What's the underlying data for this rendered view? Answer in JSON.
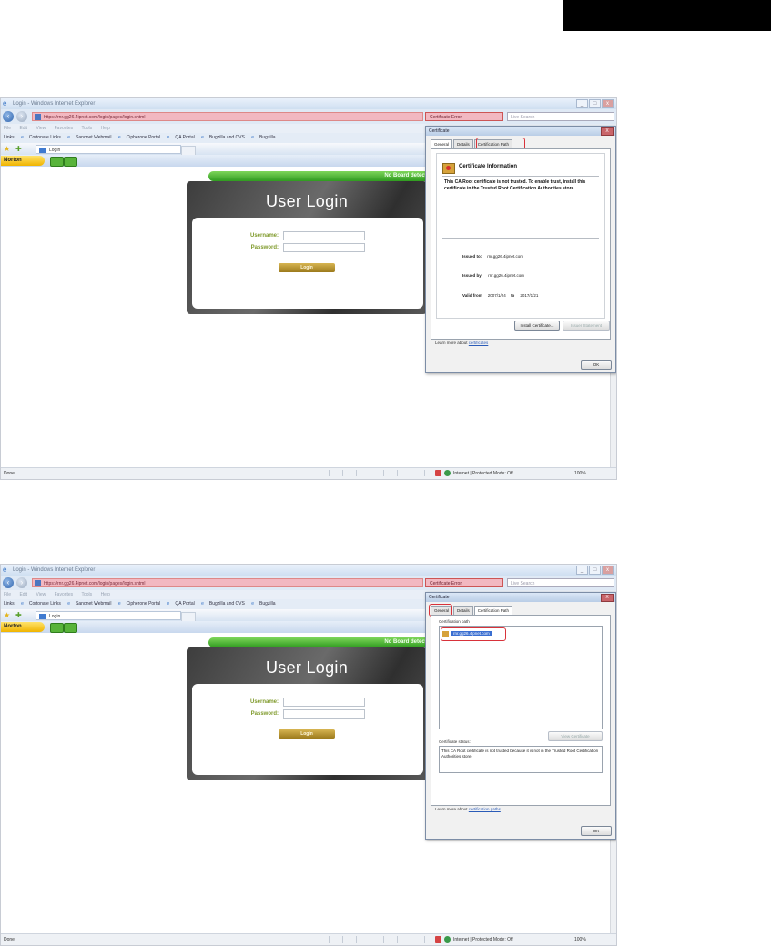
{
  "browser": {
    "window_title": "Login - Windows Internet Explorer",
    "url": "https://rnr.gg26.4ipnet.com/login/pages/login.shtml",
    "cert_error": "Certificate Error",
    "search_placeholder": "Live Search",
    "menu": [
      "File",
      "Edit",
      "View",
      "Favorites",
      "Tools",
      "Help"
    ],
    "links": [
      "Links",
      "Cortonate Links",
      "Sandnet Webmail",
      "Cipherone Portal",
      "QA Portal",
      "Bugzilla and CVS",
      "Bugzilla"
    ],
    "tab_label": "Login",
    "norton_label": "Norton",
    "status_done": "Done",
    "status_zone": "Internet | Protected Mode: Off",
    "status_zoom": "100%"
  },
  "page": {
    "banner": "No Board detected",
    "login_title": "User Login",
    "username_label": "Username:",
    "password_label": "Password:",
    "login_button": "Login"
  },
  "dialog": {
    "title": "Certificate",
    "close": "X",
    "tabs": [
      "General",
      "Details",
      "Certification Path"
    ],
    "info_title": "Certificate Information",
    "warning": "This CA Root certificate is not trusted. To enable trust, install this certificate in the Trusted Root Certification Authorities store.",
    "issued_to_label": "Issued to:",
    "issued_to": "rnr.gg26.4ipnet.com",
    "issued_by_label": "Issued by:",
    "issued_by": "rnr.gg26.4ipnet.com",
    "valid_from_label": "Valid from",
    "valid_from": "2007/1/24",
    "valid_to_label": "to",
    "valid_to": "2017/1/21",
    "install_button": "Install Certificate...",
    "issuer_statement_button": "Issuer Statement",
    "learn_prefix": "Learn more about",
    "learn_link_general": "certificates",
    "ok_button": "OK",
    "path_label": "Certification path",
    "path_item": "rnr.gg26.4ipnet.com",
    "view_cert_button": "View Certificate",
    "status_label": "Certificate status:",
    "status_text": "This CA Root certificate is not trusted because it is not in the Trusted Root Certification Authorities store.",
    "learn_link_path": "certification paths"
  }
}
